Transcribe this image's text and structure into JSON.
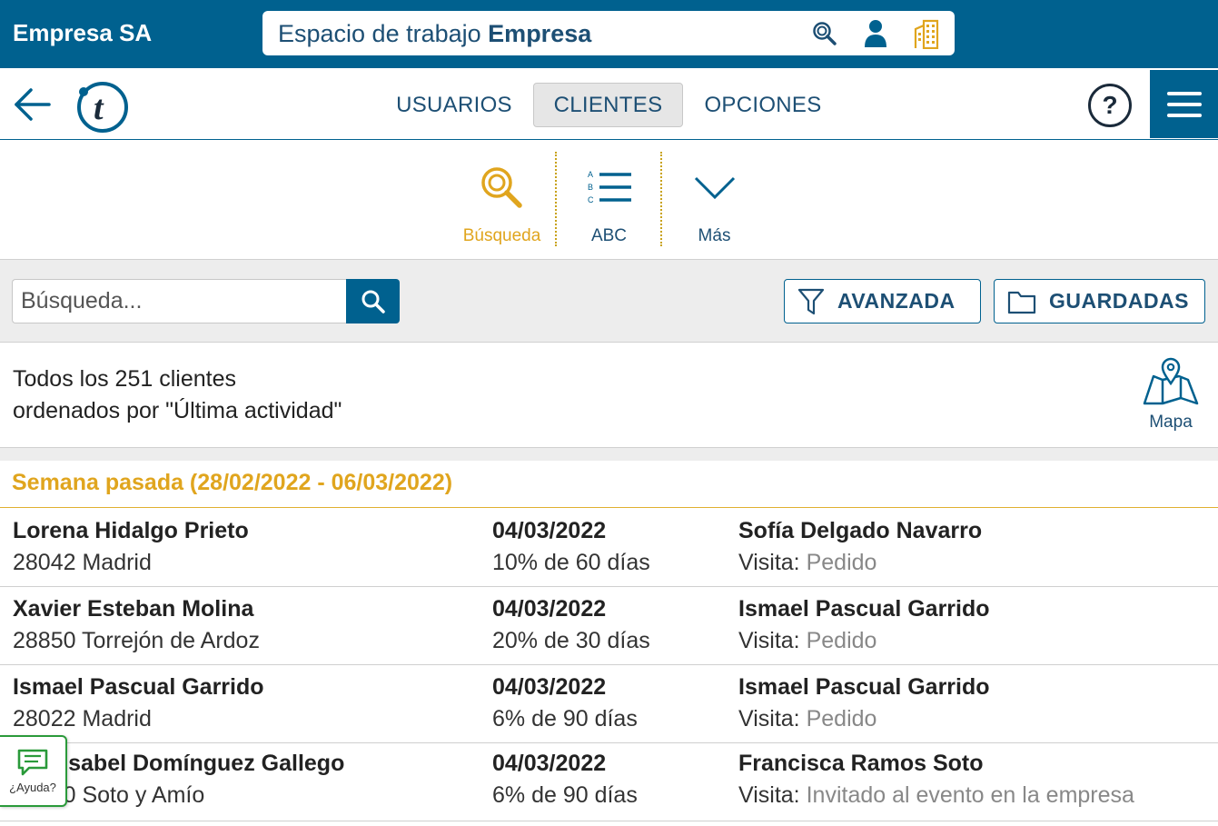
{
  "header": {
    "brand": "Empresa SA",
    "workspace_prefix": "Espacio de trabajo",
    "workspace_name": "Empresa",
    "icons": [
      "search-icon",
      "user-icon",
      "building-icon"
    ]
  },
  "nav": {
    "tabs": [
      {
        "label": "USUARIOS",
        "active": false
      },
      {
        "label": "CLIENTES",
        "active": true
      },
      {
        "label": "OPCIONES",
        "active": false
      }
    ],
    "help_label": "?",
    "accent_color": "#00618f"
  },
  "toolbar": {
    "items": [
      {
        "label": "Búsqueda",
        "icon": "search-icon",
        "active": true
      },
      {
        "label": "ABC",
        "icon": "abc-list-icon",
        "active": false
      },
      {
        "label": "Más",
        "icon": "chevron-down-icon",
        "active": false
      }
    ],
    "active_color": "#e0a51e"
  },
  "search": {
    "placeholder": "Búsqueda...",
    "advanced_label": "AVANZADA",
    "saved_label": "GUARDADAS"
  },
  "summary": {
    "line1": "Todos los 251 clientes",
    "line2": "ordenados por \"Última actividad\"",
    "map_label": "Mapa"
  },
  "list": {
    "section_title": "Semana pasada (28/02/2022 - 06/03/2022)",
    "rows": [
      {
        "name": "Lorena Hidalgo Prieto",
        "location": "28042 Madrid",
        "date": "04/03/2022",
        "progress": "10% de 60 días",
        "agent": "Sofía Delgado Navarro",
        "visit_label": "Visita:",
        "visit_value": "Pedido"
      },
      {
        "name": "Xavier Esteban Molina",
        "location": "28850 Torrejón de Ardoz",
        "date": "04/03/2022",
        "progress": "20% de 30 días",
        "agent": "Ismael Pascual Garrido",
        "visit_label": "Visita:",
        "visit_value": "Pedido"
      },
      {
        "name": "Ismael Pascual Garrido",
        "location": "28022 Madrid",
        "date": "04/03/2022",
        "progress": "6% de 90 días",
        "agent": "Ismael Pascual Garrido",
        "visit_label": "Visita:",
        "visit_value": "Pedido"
      },
      {
        "name": "Ana Isabel Domínguez Gallego",
        "location": "24120 Soto y Amío",
        "date": "04/03/2022",
        "progress": "6% de 90 días",
        "agent": "Francisca Ramos Soto",
        "visit_label": "Visita:",
        "visit_value": "Invitado al evento en la empresa"
      }
    ]
  },
  "ayuda": {
    "label": "¿Ayuda?",
    "color": "#2a9a3a"
  }
}
